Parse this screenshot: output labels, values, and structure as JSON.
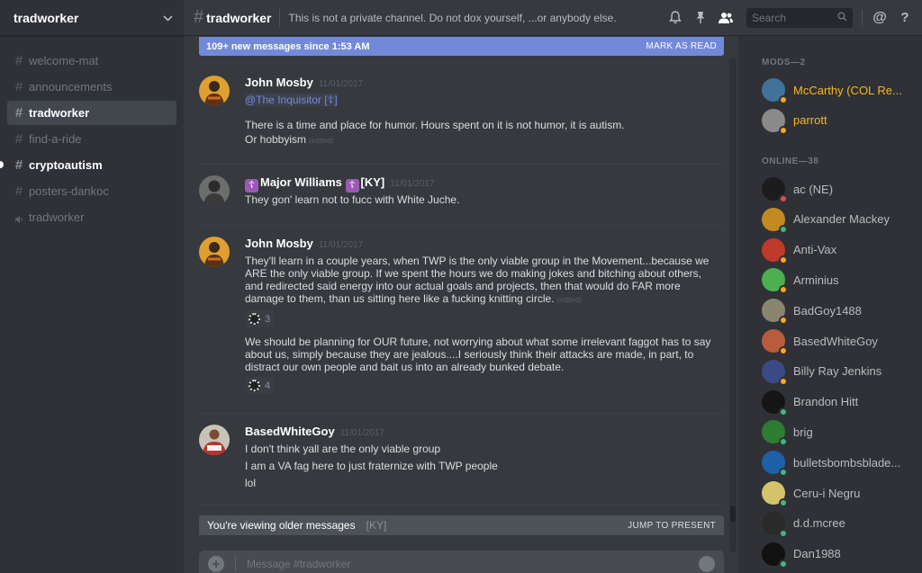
{
  "guild": {
    "name": "tradworker"
  },
  "channels": [
    {
      "name": "welcome-mat",
      "type": "text",
      "state": "normal"
    },
    {
      "name": "announcements",
      "type": "text",
      "state": "normal"
    },
    {
      "name": "tradworker",
      "type": "text",
      "state": "active"
    },
    {
      "name": "find-a-ride",
      "type": "text",
      "state": "normal"
    },
    {
      "name": "cryptoautism",
      "type": "text",
      "state": "unread"
    },
    {
      "name": "posters-dankoc",
      "type": "text",
      "state": "normal"
    },
    {
      "name": "tradworker",
      "type": "voice",
      "state": "normal"
    }
  ],
  "topbar": {
    "channel": "tradworker",
    "topic": "This is not a private channel. Do not dox yourself, ...or anybody else.",
    "search_placeholder": "Search",
    "icons": [
      "bell-icon",
      "pin-icon",
      "members-icon",
      "search-icon",
      "mention-icon",
      "help-icon"
    ]
  },
  "new_messages_bar": {
    "text": "109+ new messages since 1:53 AM",
    "action": "MARK AS READ"
  },
  "messages": [
    {
      "author": "John Mosby",
      "timestamp": "11/01/2017",
      "mention": "@The Inquisitor [☦]",
      "lines": [
        {
          "text": "There is a time and place for humor. Hours spent on it is not humor, it is autism.",
          "edited": false
        },
        {
          "text": "Or hobbyism",
          "edited": true
        }
      ]
    },
    {
      "author_badge": "☦",
      "author": "Major Williams",
      "author_suffix": "[KY]",
      "timestamp": "11/01/2017",
      "lines": [
        {
          "text": "They gon' learn not to fucc with White Juche."
        }
      ]
    },
    {
      "author": "John Mosby",
      "timestamp": "11/01/2017",
      "paragraph1": "They'll learn in a couple years, when TWP is the only viable group in the Movement...because we ARE the only viable group. If we spent the hours we do making jokes and bitching about others, and redirected said energy into our actual goals and projects, then that would do FAR more damage to them, than us sitting here like a fucking knitting circle.",
      "reaction1_count": "3",
      "paragraph2": "We should be planning for OUR future, not worrying about what some irrelevant faggot has to say about us, simply because they are jealous....I seriously think their attacks are made, in part, to distract our own people and bait us into an already bunked debate.",
      "reaction2_count": "4"
    },
    {
      "author": "BasedWhiteGoy",
      "timestamp": "11/01/2017",
      "lines": [
        {
          "text": "I don't think yall are the only viable group"
        },
        {
          "text": "I am a VA fag here to just fraternize with TWP people"
        },
        {
          "text": "lol"
        }
      ]
    }
  ],
  "older_bar": {
    "text": "You're viewing older messages",
    "action": "JUMP TO PRESENT",
    "peek": "[KY]"
  },
  "composer": {
    "placeholder": "Message #tradworker"
  },
  "members": {
    "mods_label": "MODS—2",
    "mods": [
      {
        "name": "McCarthy (COL Re...",
        "status": "idle",
        "avatar": "#41729a"
      },
      {
        "name": "parrott",
        "status": "idle",
        "avatar": "#8a8a8a"
      }
    ],
    "online_label": "ONLINE—38",
    "online": [
      {
        "name": "ac (NE)",
        "status": "dnd",
        "avatar": "#1c1c1c"
      },
      {
        "name": "Alexander Mackey",
        "status": "online",
        "avatar": "#c38a23"
      },
      {
        "name": "Anti-Vax",
        "status": "idle",
        "avatar": "#c0392b"
      },
      {
        "name": "Arminius",
        "status": "idle",
        "avatar": "#4caf50"
      },
      {
        "name": "BadGoy1488",
        "status": "idle",
        "avatar": "#8b8570"
      },
      {
        "name": "BasedWhiteGoy",
        "status": "idle",
        "avatar": "#b85c3c"
      },
      {
        "name": "Billy Ray Jenkins",
        "status": "idle",
        "avatar": "#3b4a86"
      },
      {
        "name": "Brandon Hitt",
        "status": "online",
        "avatar": "#151515"
      },
      {
        "name": "brig",
        "status": "online",
        "avatar": "#2e7d32"
      },
      {
        "name": "bulletsbombsblade...",
        "status": "online",
        "avatar": "#1e5fa8"
      },
      {
        "name": "Ceru-i Negru",
        "status": "online",
        "avatar": "#d4c36a"
      },
      {
        "name": "d.d.mcree",
        "status": "online",
        "avatar": "#2a2a2a"
      },
      {
        "name": "Dan1988",
        "status": "online",
        "avatar": "#111111"
      }
    ]
  },
  "colors": {
    "online": "#43b581",
    "idle": "#faa61a",
    "dnd": "#f04747",
    "accent": "#7289da",
    "mod": "#f5b81d"
  }
}
